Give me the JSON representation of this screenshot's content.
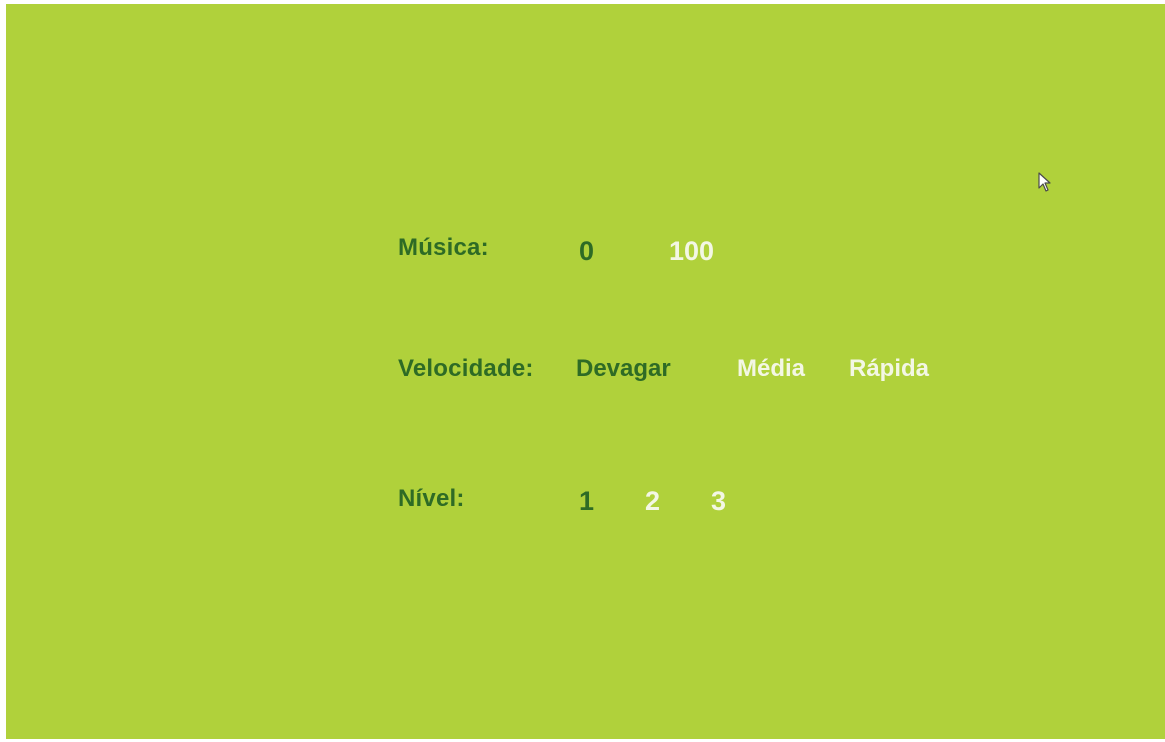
{
  "settings": {
    "music": {
      "label": "Música:",
      "options": [
        "0",
        "100"
      ],
      "selected": "0"
    },
    "speed": {
      "label": "Velocidade:",
      "options": [
        "Devagar",
        "Média",
        "Rápida"
      ],
      "selected": "Devagar"
    },
    "level": {
      "label": "Nível:",
      "options": [
        "1",
        "2",
        "3"
      ],
      "selected": "1"
    }
  },
  "colors": {
    "background": "#b0d13b",
    "selected_text": "#2e6b25",
    "unselected_text": "#f3f7e4"
  },
  "icons": {
    "cursor": "mouse-pointer-icon"
  }
}
